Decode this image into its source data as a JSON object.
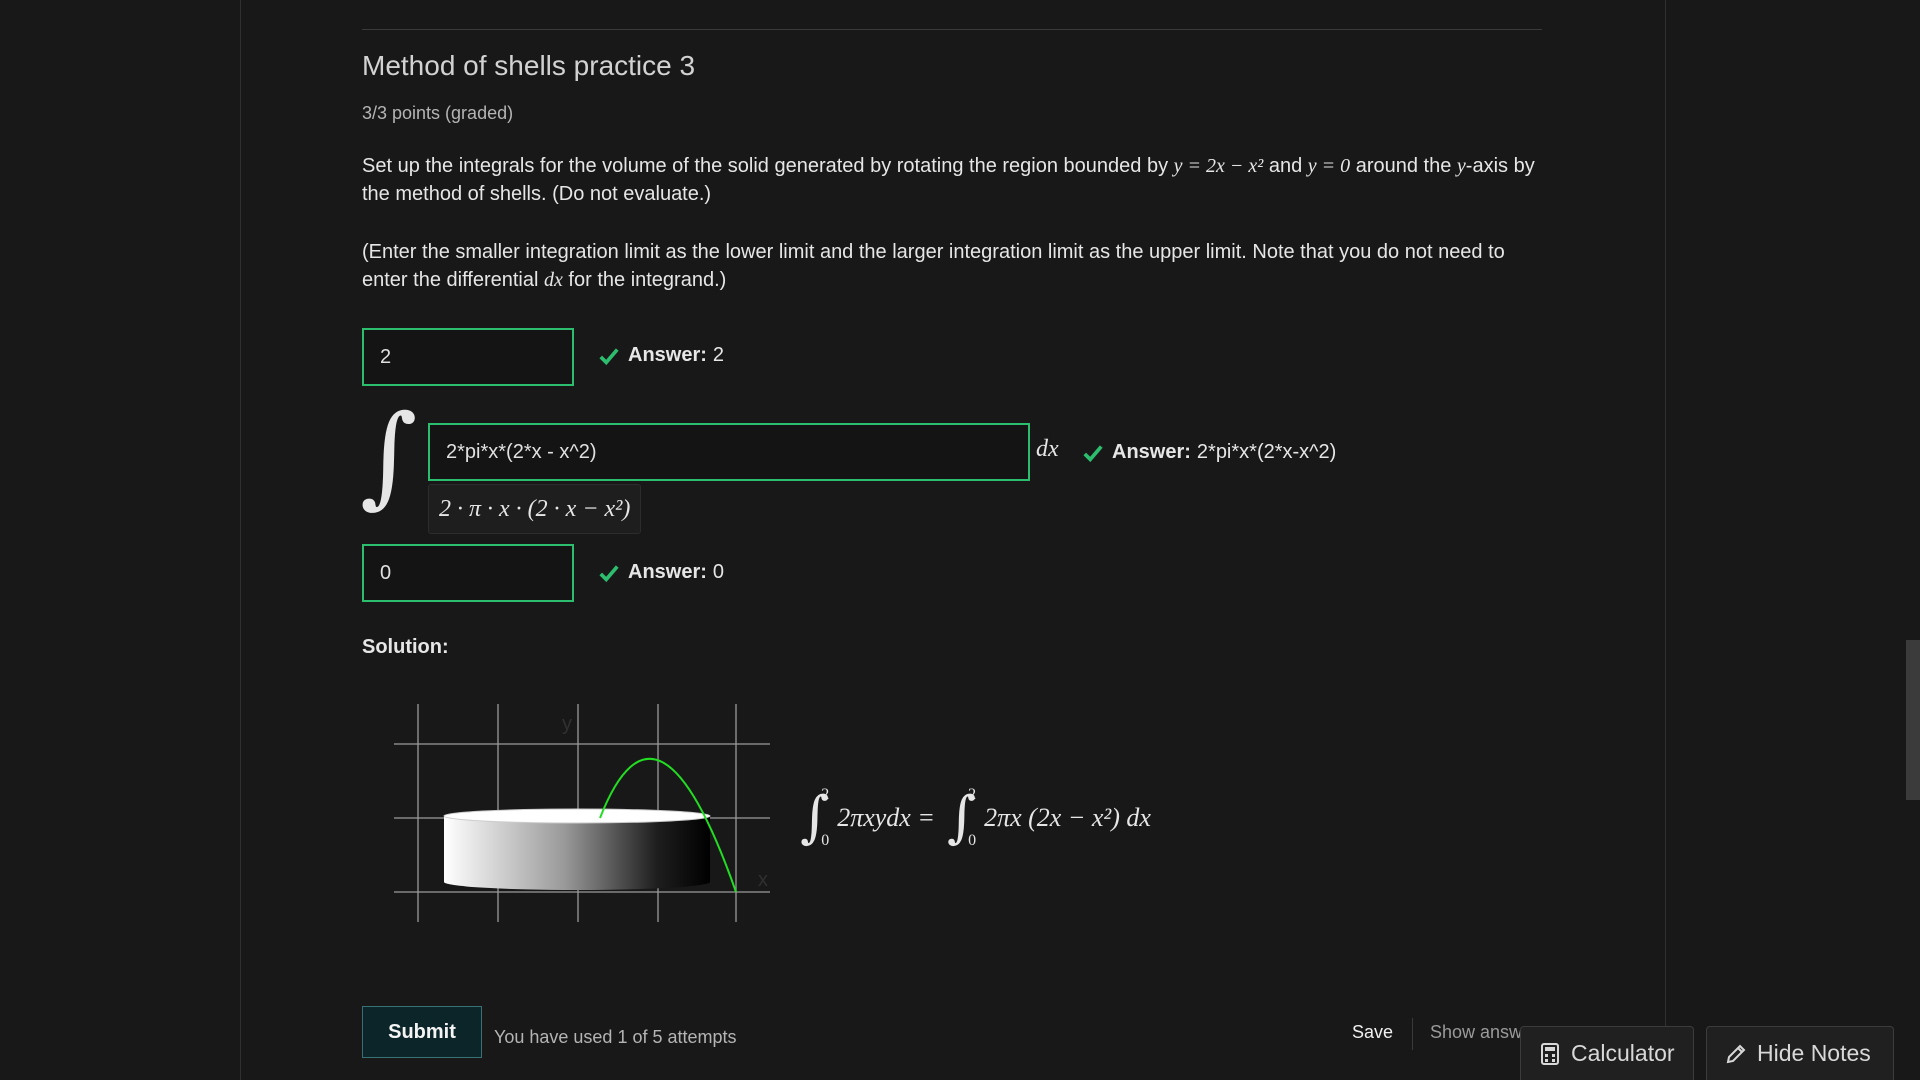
{
  "problem": {
    "title": "Method of shells practice 3",
    "points": "3/3 points (graded)",
    "p1": {
      "t1": "Set up the integrals for the volume of the solid generated by rotating the region bounded by ",
      "m1": "y = 2x − x²",
      "t2": " and ",
      "m2": "y = 0",
      "t3": " around the ",
      "m3": "y",
      "t4": "-axis by the method of shells. (Do not evaluate.)"
    },
    "p2": {
      "t1": "(Enter the smaller integration limit as the lower limit and the larger integration limit as the upper limit. Note that you do not need to enter the differential ",
      "m1": "dx",
      "t2": " for the integrand.)"
    }
  },
  "inputs": {
    "upper": {
      "value": "2",
      "answer_label": "Answer:",
      "answer": "2"
    },
    "integrand": {
      "value": "2*pi*x*(2*x - x^2)",
      "answer_label": "Answer:",
      "answer": "2*pi*x*(2*x-x^2)",
      "preview": "2 · π · x · (2 · x − x²)",
      "differential": "dx"
    },
    "lower": {
      "value": "0",
      "answer_label": "Answer:",
      "answer": "0"
    }
  },
  "solution": {
    "label": "Solution:",
    "axis_y": "y",
    "axis_x": "x",
    "formula_left": "2πxydx =",
    "formula_right": "2πx (2x − x²) dx",
    "upper_limit": "2",
    "lower_limit": "0"
  },
  "footer": {
    "submit": "Submit",
    "attempts": "You have used 1 of 5 attempts",
    "save": "Save",
    "show_answer": "Show answ"
  },
  "tools": {
    "calculator": "Calculator",
    "hide_notes": "Hide Notes"
  },
  "colors": {
    "correct": "#2dbd6e",
    "curve": "#22dd22",
    "background": "#181818"
  }
}
